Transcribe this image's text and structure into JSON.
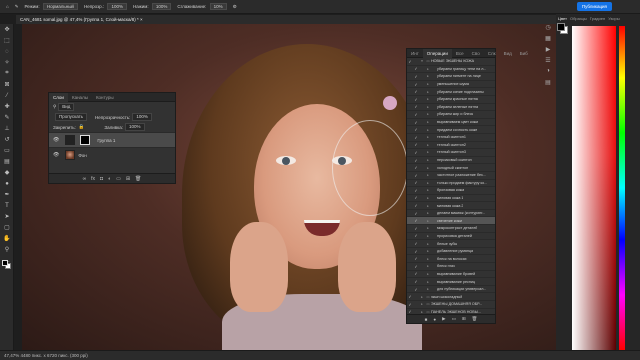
{
  "options_bar": {
    "mode_label": "Режим:",
    "mode_value": "Нормальный",
    "opacity_label": "Непрозр.:",
    "opacity_value": "100%",
    "flow_label": "Нажим:",
    "flow_value": "100%",
    "smoothing_label": "Сглаживание:",
    "smoothing_value": "10%",
    "publish_button": "Публикация"
  },
  "document": {
    "tab_title": "CAN_4681 somal.jpg @ 47,4% (Группа 1, Слой-маска/8) *"
  },
  "layers_panel": {
    "tabs": [
      "Слои",
      "Каналы",
      "Контуры"
    ],
    "active_tab": 0,
    "filter_label": "Вид",
    "blend_mode": "Пропускать",
    "opacity_label": "Непрозрачность:",
    "opacity_value": "100%",
    "lock_label": "Закрепить:",
    "fill_label": "Заливка:",
    "fill_value": "100%",
    "layers": [
      {
        "name": "Группа 1",
        "type": "group",
        "selected": true,
        "visible": true
      },
      {
        "name": "Фон",
        "type": "image",
        "selected": false,
        "visible": true
      }
    ]
  },
  "actions_panel": {
    "tabs": [
      "Инт",
      "Операции",
      "Все",
      "Сво",
      "Слк",
      "Вид",
      "Биб"
    ],
    "active_tab": 1,
    "items": [
      {
        "label": "НОВЫЕ ЭКШЕНЫ КОЖА",
        "type": "folder"
      },
      {
        "label": "убираем границу тени на л...",
        "type": "action"
      },
      {
        "label": "убираем пигмент на лице",
        "type": "action"
      },
      {
        "label": "уменьшение шума",
        "type": "action"
      },
      {
        "label": "убираем синие подглазины",
        "type": "action"
      },
      {
        "label": "убираем красные пятна",
        "type": "action"
      },
      {
        "label": "убираем зеленые пятна",
        "type": "action"
      },
      {
        "label": "убираем жир и блеск",
        "type": "action"
      },
      {
        "label": "выравниваем цвет кожи",
        "type": "action"
      },
      {
        "label": "придаем сочность коже",
        "type": "action"
      },
      {
        "label": "теплый скинтон1",
        "type": "action"
      },
      {
        "label": "теплый скинтон2",
        "type": "action"
      },
      {
        "label": "теплый скинтон3",
        "type": "action"
      },
      {
        "label": "персиковый скинтон",
        "type": "action"
      },
      {
        "label": "холодный скинтон",
        "type": "action"
      },
      {
        "label": "частотное разложение без...",
        "type": "action"
      },
      {
        "label": "только придаем фактуру ко...",
        "type": "action"
      },
      {
        "label": "бронзовая кожа",
        "type": "action"
      },
      {
        "label": "матовая кожа 1",
        "type": "action"
      },
      {
        "label": "матовая кожа 2",
        "type": "action"
      },
      {
        "label": "делаем макияж (контуринг...",
        "type": "action"
      },
      {
        "label": "свечение кожи",
        "type": "action",
        "selected": true
      },
      {
        "label": "микроконтраст деталей",
        "type": "action"
      },
      {
        "label": "прорисовка деталей",
        "type": "action"
      },
      {
        "label": "белые зубы",
        "type": "action"
      },
      {
        "label": "добавление румянца",
        "type": "action"
      },
      {
        "label": "блеск на волосах",
        "type": "action"
      },
      {
        "label": "блеск глаз",
        "type": "action"
      },
      {
        "label": "выравнивание бровей",
        "type": "action"
      },
      {
        "label": "выравнивание ресниц",
        "type": "action"
      },
      {
        "label": "для публикации универсал...",
        "type": "action"
      },
      {
        "label": "экшн шоколадный",
        "type": "folder-closed"
      },
      {
        "label": "ЭКШЕНЫ ДОМАШНЯЯ ОБР...",
        "type": "folder-closed"
      },
      {
        "label": "ПАНЕЛЬ ЭКШЕНОВ НОВЫ...",
        "type": "folder-closed"
      }
    ]
  },
  "color_panel": {
    "tabs": [
      "Цвет",
      "Образцы",
      "Градиен",
      "Узоры"
    ],
    "active_tab": 0,
    "hue_color": "#ff0000"
  },
  "status_bar": {
    "text": "47,47%    4480 пикс. x 6720 пикс. (300 ppi)"
  },
  "colors": {
    "accent": "#1473e6",
    "foreground": "#000000",
    "background": "#ffffff"
  }
}
